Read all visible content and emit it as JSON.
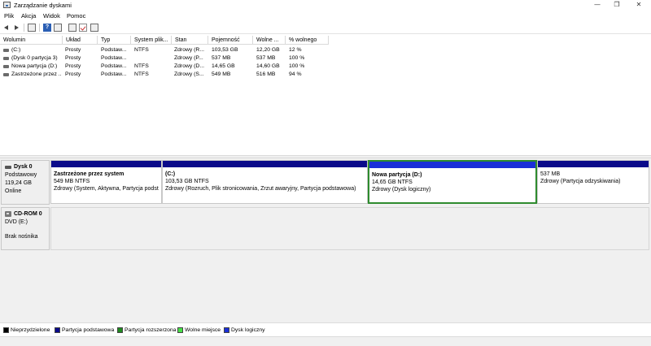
{
  "window": {
    "title": "Zarządzanie dyskami"
  },
  "menu": [
    "Plik",
    "Akcja",
    "Widok",
    "Pomoc"
  ],
  "toolbar": {
    "icons": [
      "back-icon",
      "forward-icon",
      "properties-icon",
      "view-icon",
      "help-icon",
      "disk-icon",
      "check-icon",
      "list-icon"
    ],
    "help_glyph": "?"
  },
  "volume_table": {
    "columns": [
      "Wolumin",
      "Układ",
      "Typ",
      "System plik...",
      "Stan",
      "Pojemność",
      "Wolne ...",
      "% wolnego"
    ],
    "rows": [
      [
        "(C:)",
        "Prosty",
        "Podstaw...",
        "NTFS",
        "Zdrowy (R...",
        "103,53 GB",
        "12,20 GB",
        "12 %"
      ],
      [
        "(Dysk 0 partycja 3)",
        "Prosty",
        "Podstaw...",
        "",
        "Zdrowy (P...",
        "537 MB",
        "537 MB",
        "100 %"
      ],
      [
        "Nowa partycja (D:)",
        "Prosty",
        "Podstaw...",
        "NTFS",
        "Zdrowy (D...",
        "14,65 GB",
        "14,60 GB",
        "100 %"
      ],
      [
        "Zastrzeżone przez ...",
        "Prosty",
        "Podstaw...",
        "NTFS",
        "Zdrowy (S...",
        "549 MB",
        "516 MB",
        "94 %"
      ]
    ]
  },
  "disks": [
    {
      "name": "Dysk 0",
      "type": "Podstawowy",
      "size": "119,24 GB",
      "status": "Online",
      "partitions": [
        {
          "name": "Zastrzeżone przez system",
          "size": "549 MB NTFS",
          "status": "Zdrowy (System, Aktywna, Partycja podst",
          "bar_color": "#0a0a8a"
        },
        {
          "name": "(C:)",
          "size": "103,53 GB NTFS",
          "status": "Zdrowy (Rozruch, Plik stronicowania, Zrzut awaryjny, Partycja podstawowa)",
          "bar_color": "#0a0a8a"
        },
        {
          "name": "Nowa partycja  (D:)",
          "size": "14,65 GB NTFS",
          "status": "Zdrowy (Dysk logiczny)",
          "bar_color": "#1a2fd8"
        },
        {
          "name": "",
          "size": "537 MB",
          "status": "Zdrowy (Partycja odzyskiwania)",
          "bar_color": "#0a0a8a"
        }
      ]
    },
    {
      "name": "CD-ROM 0",
      "type": "DVD (E:)",
      "size": "",
      "status": "Brak nośnika",
      "partitions": []
    }
  ],
  "legend": [
    {
      "label": "Nieprzydzielone",
      "color": "#000000"
    },
    {
      "label": "Partycja podstawowa",
      "color": "#0a0a8a"
    },
    {
      "label": "Partycja rozszerzona",
      "color": "#1f8a1f"
    },
    {
      "label": "Wolne miejsce",
      "color": "#46e046"
    },
    {
      "label": "Dysk logiczny",
      "color": "#1a2fd8"
    }
  ],
  "window_controls": [
    "—",
    "❐",
    "✕"
  ]
}
